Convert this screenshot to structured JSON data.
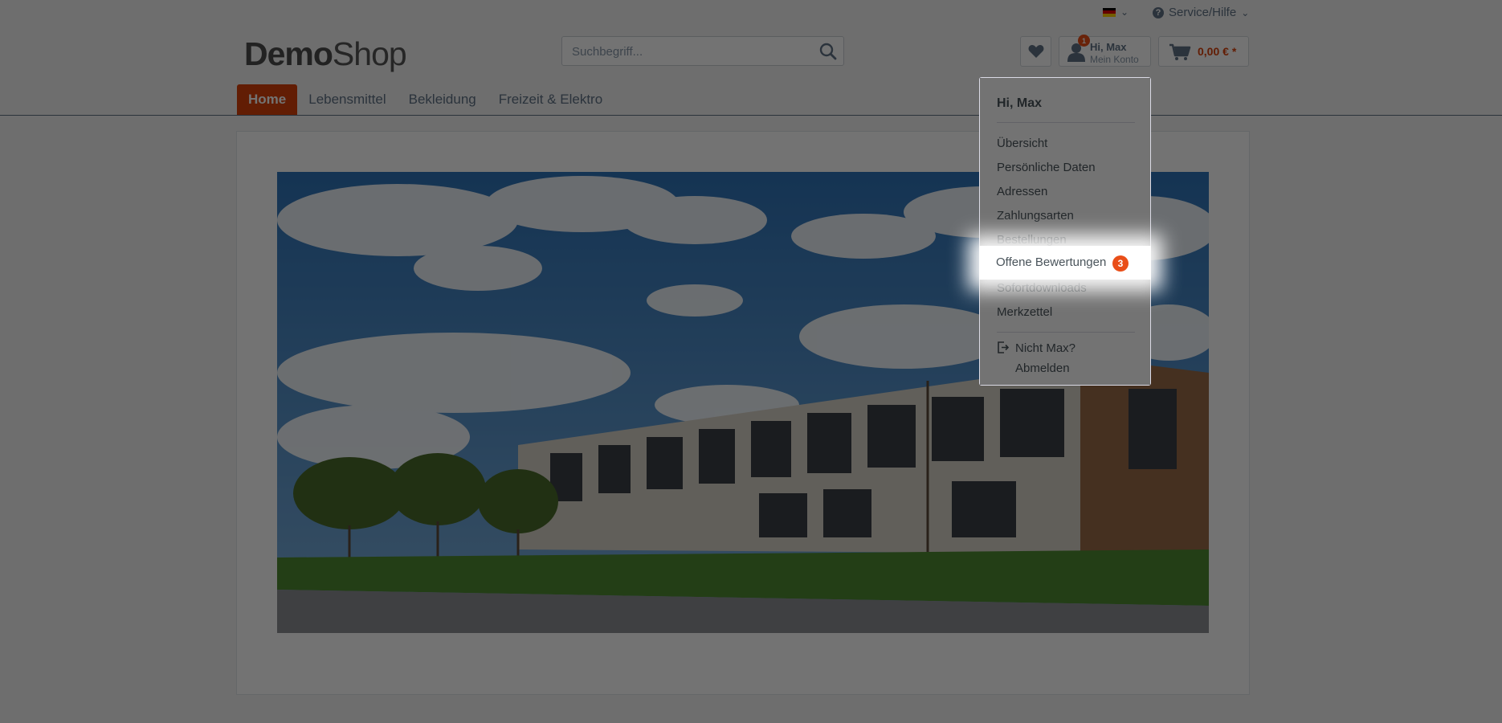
{
  "header": {
    "language_chevron": "⌄",
    "service_label": "Service/Hilfe",
    "service_icon": "?",
    "logo_bold": "Demo",
    "logo_light": "Shop",
    "search_placeholder": "Suchbegriff...",
    "account_notification_count": "1",
    "account_greeting": "Hi, Max",
    "account_label": "Mein Konto",
    "cart_amount": "0,00 € *"
  },
  "nav": {
    "items": [
      {
        "label": "Home",
        "active": true
      },
      {
        "label": "Lebensmittel",
        "active": false
      },
      {
        "label": "Bekleidung",
        "active": false
      },
      {
        "label": "Freizeit & Elektro",
        "active": false
      }
    ]
  },
  "account_menu": {
    "greeting": "Hi, Max",
    "items": [
      "Übersicht",
      "Persönliche Daten",
      "Adressen",
      "Zahlungsarten",
      "Bestellungen",
      "Offene Bewertungen",
      "Sofortdownloads",
      "Merkzettel"
    ],
    "open_reviews_count": "3",
    "logout_line1": "Nicht Max?",
    "logout_line2": "Abmelden"
  },
  "colors": {
    "accent": "#d9400b",
    "badge": "#e94e18",
    "text": "#5f7285"
  }
}
